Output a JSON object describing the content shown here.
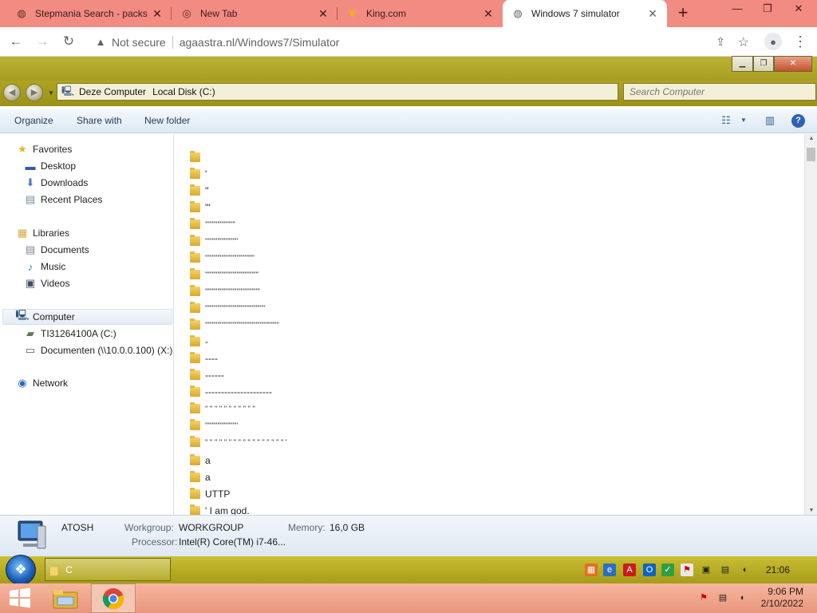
{
  "browser": {
    "tabs": [
      {
        "title": "Stepmania Search - packs",
        "icon": "globe-icon"
      },
      {
        "title": "New Tab",
        "icon": "chrome-icon"
      },
      {
        "title": "King.com",
        "icon": "crown-icon"
      },
      {
        "title": "Windows 7 simulator",
        "icon": "globe-icon"
      }
    ],
    "security": "Not secure",
    "url": "agaastra.nl/Windows7/Simulator"
  },
  "explorer": {
    "breadcrumbs": [
      "Deze Computer",
      "Local Disk (C:)"
    ],
    "search_placeholder": "Search Computer",
    "commands": {
      "organize": "Organize",
      "share": "Share with",
      "new_folder": "New folder"
    },
    "nav": {
      "favorites": {
        "label": "Favorites",
        "items": [
          "Desktop",
          "Downloads",
          "Recent Places"
        ]
      },
      "libraries": {
        "label": "Libraries",
        "items": [
          "Documents",
          "Music",
          "Videos"
        ]
      },
      "computer": {
        "label": "Computer",
        "items": [
          "TI31264100A (C:)",
          "Documenten (\\\\10.0.0.100) (X:)"
        ]
      },
      "network": {
        "label": "Network"
      }
    },
    "files": [
      "",
      "'",
      "''",
      "'''",
      "''''''''''''''''''''''",
      "''''''''''''''''''''''''",
      "''''''''''''''''''''''''''''''''''''",
      "'''''''''''''''''''''''''''''''''''''''",
      "''''''''''''''''''''''''''''''''''''''''",
      "''''''''''''''''''''''''''''''''''''''''''''",
      "''''''''''''''''''''''''''''''''''''''''''''''''''''''",
      "-",
      "----",
      "------",
      "---------------------",
      "'' '' '' '' '' '' '' '' '' '' ''",
      "''''''''''''''''''''''''",
      "'' '' '' '' '' '' '' '' '' '' '' '' '' '' '' '' '' '",
      "a",
      "a",
      "UTTP",
      "' I am god."
    ],
    "details": {
      "name": "ATOSH",
      "workgroup_label": "Workgroup:",
      "workgroup": "WORKGROUP",
      "memory_label": "Memory:",
      "memory": "16,0 GB",
      "processor_label": "Processor:",
      "processor": "Intel(R) Core(TM) i7-46..."
    }
  },
  "sim_taskbar": {
    "task_label": "C",
    "clock": "21:06"
  },
  "os_taskbar": {
    "time": "9:06 PM",
    "date": "2/10/2022"
  }
}
